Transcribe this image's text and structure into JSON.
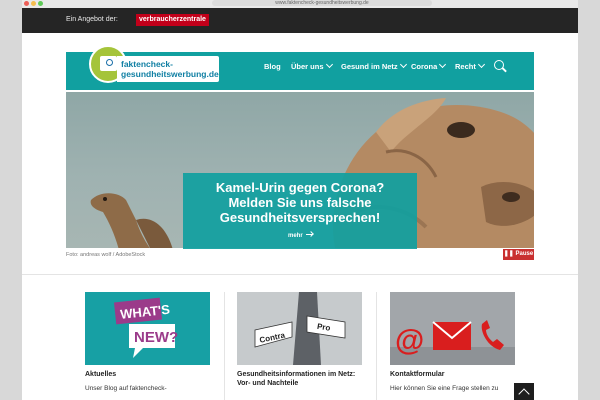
{
  "browser": {
    "url": "www.faktencheck-gesundheitswerbung.de"
  },
  "topbar": {
    "offer_text": "Ein Angebot der:",
    "org_logo_text": "verbraucherzentrale"
  },
  "header": {
    "logo_line1": "faktencheck-",
    "logo_line2": "gesundheitswerbung.de",
    "menu": [
      {
        "label": "Blog"
      },
      {
        "label": "Über uns"
      },
      {
        "label": "Gesund im Netz"
      },
      {
        "label": "Corona"
      },
      {
        "label": "Recht"
      }
    ]
  },
  "hero": {
    "headline_line1": "Kamel-Urin gegen Corona?",
    "headline_line2": "Melden Sie uns falsche",
    "headline_line3": "Gesundheitsversprechen!",
    "more_label": "mehr",
    "photo_credit": "Foto: andreas wolf / AdobeStock",
    "pause_label": "Pause"
  },
  "cards": [
    {
      "title": "Aktuelles",
      "text_line1": "Unser Blog auf faktencheck-",
      "image_text_1": "WHAT'S",
      "image_text_2": "NEW?"
    },
    {
      "title_line1": "Gesundheitsinformationen im Netz:",
      "title_line2": "Vor- und Nachteile",
      "sign_contra": "Contra",
      "sign_pro": "Pro"
    },
    {
      "title": "Kontaktformular",
      "text_line1": "Hier können Sie eine Frage stellen zu"
    }
  ],
  "colors": {
    "teal": "#11a0a0",
    "lime": "#a5c43a",
    "red": "#c2001a",
    "dark": "#252525"
  }
}
